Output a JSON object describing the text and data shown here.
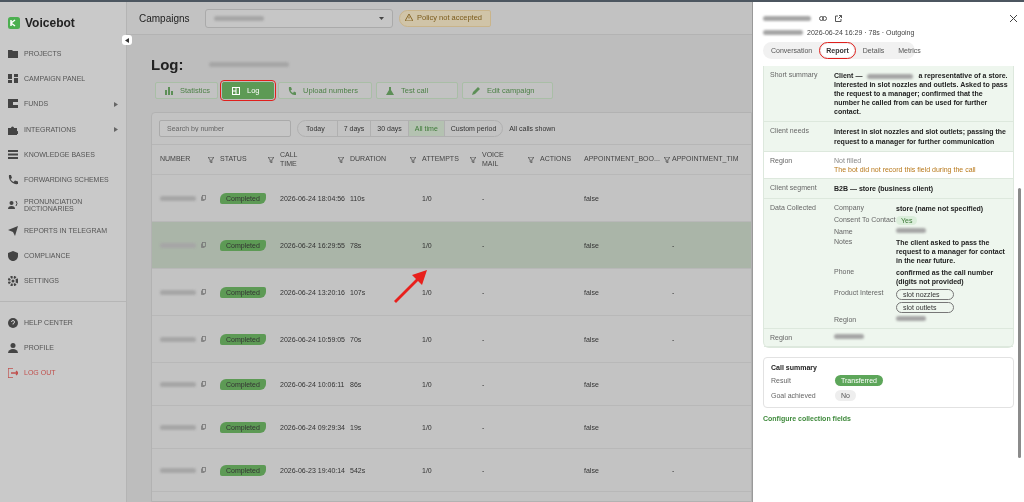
{
  "sidebar": {
    "logo": "Voicebot",
    "groups": [
      {
        "items": [
          {
            "label": "PROJECTS",
            "kind": "link",
            "expandable": false
          },
          {
            "label": "CAMPAIGN PANEL",
            "kind": "link",
            "expandable": false
          },
          {
            "label": "FUNDS",
            "kind": "link",
            "expandable": true
          },
          {
            "label": "INTEGRATIONS",
            "kind": "link",
            "expandable": true
          },
          {
            "label": "KNOWLEDGE BASES",
            "kind": "link",
            "expandable": false
          },
          {
            "label": "FORWARDING SCHEMES",
            "kind": "link",
            "expandable": false
          },
          {
            "label": "PRONUNCIATION DICTIONARIES",
            "kind": "link",
            "expandable": false
          },
          {
            "label": "REPORTS IN TELEGRAM",
            "kind": "link",
            "expandable": false
          },
          {
            "label": "COMPLIANCE",
            "kind": "link",
            "expandable": false
          },
          {
            "label": "SETTINGS",
            "kind": "link",
            "expandable": false
          }
        ]
      },
      {
        "items": [
          {
            "label": "HELP CENTER",
            "kind": "link",
            "expandable": false
          },
          {
            "label": "PROFILE",
            "kind": "link",
            "expandable": false
          },
          {
            "label": "LOG OUT",
            "kind": "danger",
            "expandable": false
          }
        ]
      }
    ]
  },
  "header": {
    "title": "Campaigns",
    "warning": "Policy not accepted"
  },
  "page": {
    "title": "Log:",
    "buttons": [
      {
        "label": "Statistics",
        "selected": false,
        "annotated": false
      },
      {
        "label": "Log",
        "selected": true,
        "annotated": true
      },
      {
        "label": "Upload numbers",
        "selected": false,
        "annotated": false
      },
      {
        "label": "Test call",
        "selected": false,
        "annotated": false
      },
      {
        "label": "Edit campaign",
        "selected": false,
        "annotated": false
      }
    ],
    "search": {
      "placeholder": "Search by number"
    },
    "periods": [
      {
        "label": "Today",
        "selected": false
      },
      {
        "label": "7 days",
        "selected": false
      },
      {
        "label": "30 days",
        "selected": false
      },
      {
        "label": "All time",
        "selected": true
      },
      {
        "label": "Custom period",
        "selected": false
      }
    ],
    "period_note": "All calls shown",
    "table": {
      "columns": [
        {
          "label": "NUMBER",
          "filter": true
        },
        {
          "label": "STATUS",
          "filter": true
        },
        {
          "label": "CALL TIME",
          "filter": true
        },
        {
          "label": "DURATION",
          "filter": true
        },
        {
          "label": "ATTEMPTS",
          "filter": true
        },
        {
          "label": "VOICE MAIL",
          "filter": true
        },
        {
          "label": "ACTIONS",
          "filter": false
        },
        {
          "label": "APPOINTMENT_BOO...",
          "filter": true
        },
        {
          "label": "APPOINTMENT_TIM",
          "filter": false
        }
      ],
      "rows": [
        {
          "selected": false,
          "status": "Completed",
          "call_time": "2026-06-24 18:04:56",
          "duration": "110s",
          "attempts": "1/0",
          "voice_mail": "-",
          "appointment_booked": "false"
        },
        {
          "selected": true,
          "status": "Completed",
          "call_time": "2026-06-24 16:29:55",
          "duration": "78s",
          "attempts": "1/0",
          "voice_mail": "-",
          "appointment_booked": "false",
          "appointment_time": "-"
        },
        {
          "selected": false,
          "status": "Completed",
          "call_time": "2026-06-24 13:20:16",
          "duration": "107s",
          "attempts": "1/0",
          "voice_mail": "-",
          "appointment_booked": "false",
          "appointment_time": "-"
        },
        {
          "selected": false,
          "status": "Completed",
          "call_time": "2026-06-24 10:59:05",
          "duration": "70s",
          "attempts": "1/0",
          "voice_mail": "-",
          "appointment_booked": "false",
          "appointment_time": "-"
        },
        {
          "selected": false,
          "status": "Completed",
          "call_time": "2026-06-24 10:06:11",
          "duration": "86s",
          "attempts": "1/0",
          "voice_mail": "-",
          "appointment_booked": "false"
        },
        {
          "selected": false,
          "status": "Completed",
          "call_time": "2026-06-24 09:29:34",
          "duration": "19s",
          "attempts": "1/0",
          "voice_mail": "-",
          "appointment_booked": "false"
        },
        {
          "selected": false,
          "status": "Completed",
          "call_time": "2026-06-23 19:40:14",
          "duration": "542s",
          "attempts": "1/0",
          "voice_mail": "-",
          "appointment_booked": "false",
          "appointment_time": "-"
        }
      ]
    }
  },
  "panel": {
    "meta": "2026-06-24 16:29 · 78s · Outgoing",
    "tabs": [
      {
        "label": "Conversation",
        "selected": false,
        "annotated": false
      },
      {
        "label": "Report",
        "selected": true,
        "annotated": true
      },
      {
        "label": "Details",
        "selected": false,
        "annotated": false
      },
      {
        "label": "Metrics",
        "selected": false,
        "annotated": false
      }
    ],
    "report": [
      {
        "kind": "summary",
        "label": "Short summary",
        "lead": "Client —",
        "value": "a representative of a store. Interested in slot nozzles and outlets. Asked to pass the request to a manager; confirmed that the number he called from can be used for further contact."
      },
      {
        "kind": "text",
        "label": "Client needs",
        "value": "Interest in slot nozzles and slot outlets; passing the request to a manager for further communication"
      },
      {
        "kind": "empty",
        "label": "Region",
        "value": "Not filled",
        "note": "The bot did not record this field during the call"
      },
      {
        "kind": "text",
        "label": "Client segment",
        "value": "B2B — store (business client)"
      },
      {
        "kind": "fields",
        "label": "Data Collected",
        "fields": [
          {
            "kind": "text",
            "label": "Company",
            "value": "store (name not specified)"
          },
          {
            "kind": "badge",
            "label": "Consent To Contact",
            "value": "Yes"
          },
          {
            "kind": "hidden",
            "label": "Name"
          },
          {
            "kind": "text",
            "label": "Notes",
            "value": "The client asked to pass the request to a manager for contact in the near future."
          },
          {
            "kind": "text",
            "label": "Phone",
            "value": "confirmed as the call number (digits not provided)"
          },
          {
            "kind": "chips",
            "label": "Product Interest",
            "values": [
              "slot nozzles",
              "slot outlets"
            ]
          },
          {
            "kind": "hidden",
            "label": "Region"
          }
        ]
      },
      {
        "kind": "hidden",
        "label": "Region"
      }
    ],
    "call_summary": {
      "title": "Call summary",
      "rows": [
        {
          "label": "Result",
          "value": "Transferred",
          "kind": "success"
        },
        {
          "label": "Goal achieved",
          "value": "No",
          "kind": "neutral"
        }
      ]
    },
    "footer_link": "Configure collection fields"
  }
}
